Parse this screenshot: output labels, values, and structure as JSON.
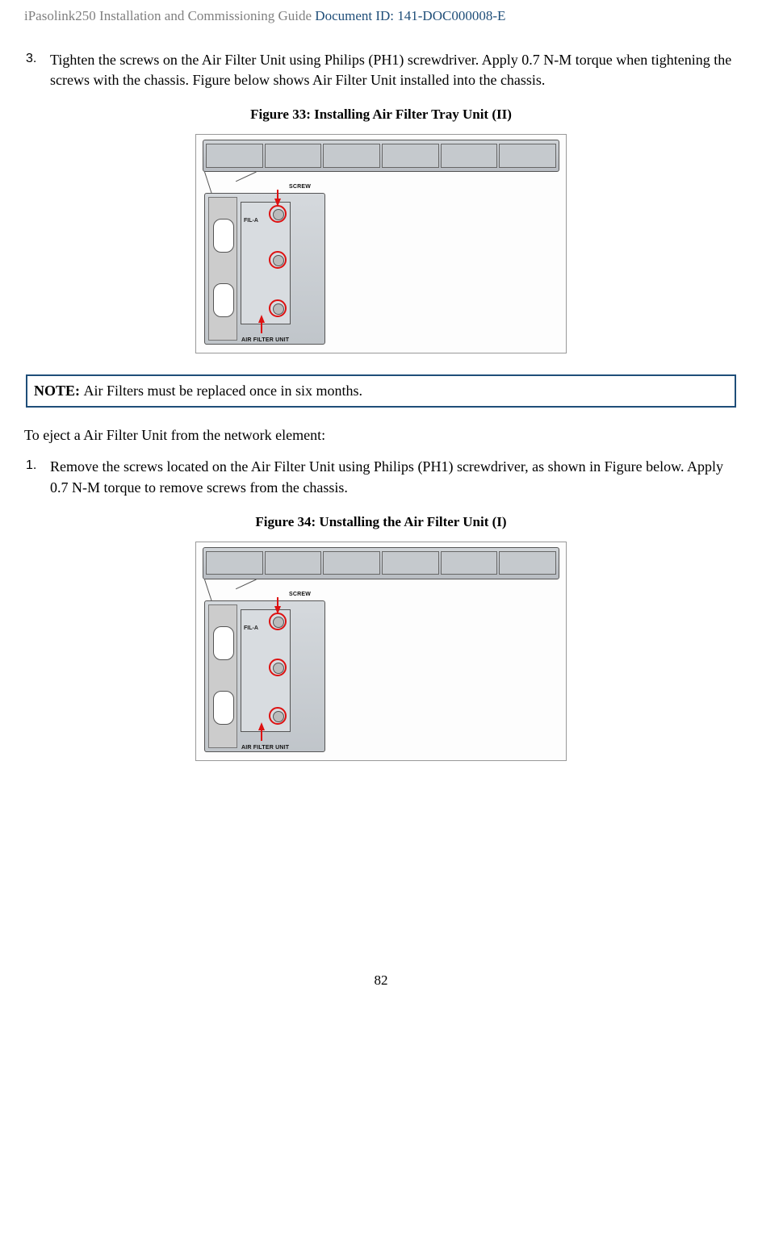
{
  "header": {
    "title": "iPasolink250 Installation and Commissioning Guide ",
    "docid": "Document ID: 141-DOC000008-E"
  },
  "step3": {
    "num": "3.",
    "text": "Tighten the screws on the Air Filter Unit using Philips (PH1) screwdriver. Apply 0.7 N-M torque when tightening the screws with the chassis. Figure below shows Air Filter Unit installed into the chassis."
  },
  "figure33": {
    "caption": "Figure 33: Installing Air Filter Tray Unit (II)",
    "labels": {
      "screw": "SCREW",
      "fil": "FIL-A",
      "unit": "AIR FILTER UNIT"
    }
  },
  "note": {
    "label": "NOTE: ",
    "text": "Air Filters must be replaced once in six months."
  },
  "eject_intro": "To eject a Air Filter Unit from the network element:",
  "step1": {
    "num": "1.",
    "text": "Remove the screws located on the Air Filter Unit using Philips (PH1) screwdriver, as shown in Figure below. Apply 0.7 N-M torque to remove screws from the chassis."
  },
  "figure34": {
    "caption": "Figure 34: Unstalling the Air Filter Unit (I)",
    "labels": {
      "screw": "SCREW",
      "fil": "FIL-A",
      "unit": "AIR FILTER UNIT"
    }
  },
  "page_number": "82"
}
